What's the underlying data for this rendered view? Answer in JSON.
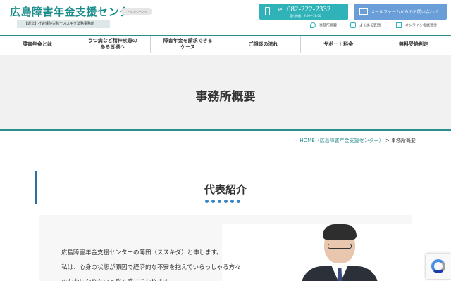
{
  "header": {
    "site_title": "広島障害年金支援センター",
    "top_page_label": "トップページへ",
    "sub_tag": "【運営】社会保険労務士ススキダ法務事務所",
    "tel": {
      "prefix": "Tel.",
      "number": "082-222-2332",
      "hours": "受付時間：9:00～18:00"
    },
    "mail_label": "メールフォームからのお問い合わせ",
    "util_links": [
      "事務所概要",
      "よくある質問",
      "オンライン相談受付"
    ]
  },
  "nav": {
    "items": [
      "障害年金とは",
      "うつ病など精神疾患の\nある皆様へ",
      "障害年金を請求できる\nケース",
      "ご相談の流れ",
      "サポート料金",
      "無料受給判定"
    ]
  },
  "hero": {
    "title": "事務所概要"
  },
  "breadcrumb": {
    "home": "HOME（広島障害年金支援センター）",
    "separator": " > ",
    "current": "事務所概要"
  },
  "section": {
    "title": "代表紹介",
    "intro_lines": [
      "広島障害年金支援センターの薄田（ススキダ）と申します。",
      "私は、心身の状態が原因で経済的な不安を抱えていらっしゃる方々",
      "のお力になりたいと強く感じております。"
    ]
  },
  "colors": {
    "brand_teal": "#1a8d8a",
    "tel_bg": "#2fb3b8",
    "mail_bg": "#6a9ed9",
    "dot_blue": "#3a86c5"
  }
}
